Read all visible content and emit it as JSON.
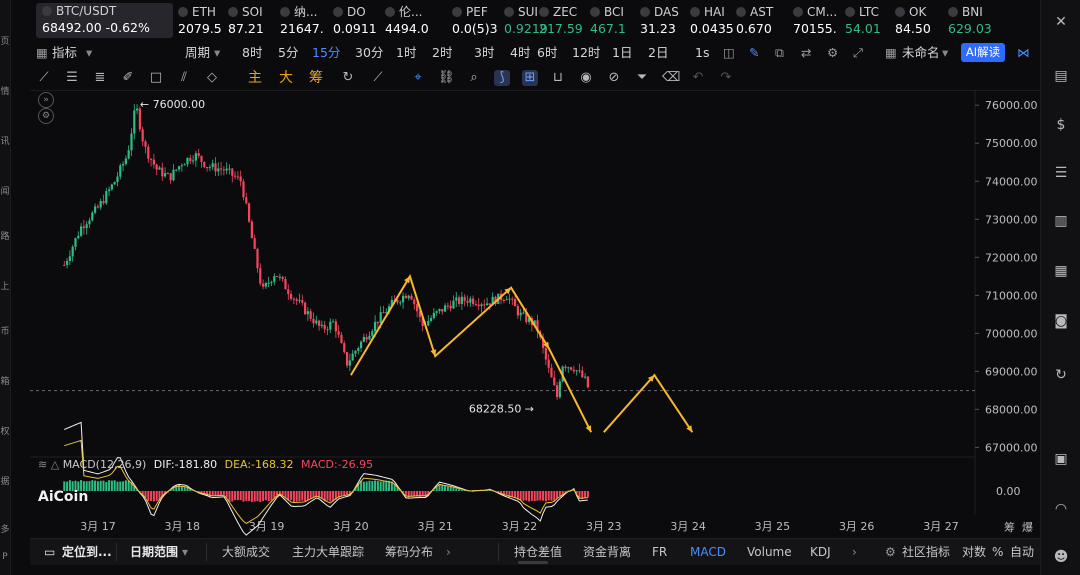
{
  "left_rail": [
    "页",
    "情",
    "讯",
    "闻",
    "路",
    "上",
    "币",
    "箱",
    "权",
    "据",
    "多",
    "P"
  ],
  "main_ticker": {
    "symbol": "BTC/USDT",
    "price": "68492.00",
    "change": "-0.62%"
  },
  "tickers": [
    {
      "sym": "ETH",
      "px": "2079.5",
      "color": "#ffffff"
    },
    {
      "sym": "SOI",
      "px": "87.21",
      "color": "#ffffff"
    },
    {
      "sym": "纳...",
      "px": "21647.",
      "color": "#ffffff"
    },
    {
      "sym": "DO",
      "px": "0.0911",
      "color": "#ffffff"
    },
    {
      "sym": "伦...",
      "px": "4494.0",
      "color": "#ffffff"
    },
    {
      "sym": "PEF",
      "px": "0.0(5)3",
      "color": "#ffffff"
    },
    {
      "sym": "SUI",
      "px": "0.9219",
      "color": "#2ebd85"
    },
    {
      "sym": "ZEC",
      "px": "217.59",
      "color": "#2ebd85"
    },
    {
      "sym": "BCI",
      "px": "467.1",
      "color": "#2ebd85"
    },
    {
      "sym": "DAS",
      "px": "31.23",
      "color": "#ffffff"
    },
    {
      "sym": "HAI",
      "px": "0.0435",
      "color": "#ffffff"
    },
    {
      "sym": "AST",
      "px": "0.670",
      "color": "#ffffff"
    },
    {
      "sym": "CM...",
      "px": "70155.",
      "color": "#ffffff"
    },
    {
      "sym": "LTC",
      "px": "54.01",
      "color": "#2ebd85"
    },
    {
      "sym": "OK",
      "px": "84.50",
      "color": "#ffffff"
    },
    {
      "sym": "BNI",
      "px": "629.03",
      "color": "#2ebd85"
    }
  ],
  "toolbar": {
    "indicator": "指标",
    "period": "周期",
    "timeframes": [
      "8时",
      "5分",
      "15分",
      "30分",
      "1时",
      "2时",
      "3时",
      "4时",
      "6时",
      "12时",
      "1日",
      "2日"
    ],
    "active_tf": "15分",
    "tick_1s": "1s",
    "unnamed": "未命名",
    "ai": "AI解读"
  },
  "draw_tools": {
    "zhu": "主",
    "da": "大",
    "chou": "筹"
  },
  "chart_data": {
    "type": "candlestick",
    "symbol": "BTC/USDT",
    "interval": "15分",
    "x_ticks": [
      "3月 17",
      "3月 18",
      "3月 19",
      "3月 20",
      "3月 21",
      "3月 22",
      "3月 23",
      "3月 24",
      "3月 25",
      "3月 26",
      "3月 27"
    ],
    "y_ticks": [
      "76000.00",
      "75000.00",
      "74000.00",
      "73000.00",
      "72000.00",
      "71000.00",
      "70000.00",
      "69000.00",
      "68000.00",
      "67000.00"
    ],
    "ylim": [
      66800,
      76400
    ],
    "high_label": "76000.00",
    "low_label": "68228.50",
    "last_price": 68492.0,
    "price_path": [
      {
        "d": "3月 16.6",
        "p": 71800
      },
      {
        "d": "3月 16.8",
        "p": 72800
      },
      {
        "d": "3月 17.0",
        "p": 73300
      },
      {
        "d": "3月 17.2",
        "p": 74000
      },
      {
        "d": "3月 17.35",
        "p": 74700
      },
      {
        "d": "3月 17.45",
        "p": 76000
      },
      {
        "d": "3月 17.55",
        "p": 74900
      },
      {
        "d": "3月 17.7",
        "p": 74300
      },
      {
        "d": "3月 17.85",
        "p": 74100
      },
      {
        "d": "3月 18.0",
        "p": 74500
      },
      {
        "d": "3月 18.15",
        "p": 74700
      },
      {
        "d": "3月 18.3",
        "p": 74400
      },
      {
        "d": "3月 18.5",
        "p": 74300
      },
      {
        "d": "3月 18.7",
        "p": 74000
      },
      {
        "d": "3月 18.85",
        "p": 72200
      },
      {
        "d": "3月 18.95",
        "p": 71100
      },
      {
        "d": "3月 19.1",
        "p": 71600
      },
      {
        "d": "3月 19.3",
        "p": 71000
      },
      {
        "d": "3月 19.5",
        "p": 70500
      },
      {
        "d": "3月 19.65",
        "p": 70100
      },
      {
        "d": "3月 19.8",
        "p": 70300
      },
      {
        "d": "3月 19.95",
        "p": 69200
      },
      {
        "d": "3月 20.1",
        "p": 69700
      },
      {
        "d": "3月 20.3",
        "p": 70300
      },
      {
        "d": "3月 20.5",
        "p": 70800
      },
      {
        "d": "3月 20.7",
        "p": 71100
      },
      {
        "d": "3月 20.85",
        "p": 70200
      },
      {
        "d": "3月 21.0",
        "p": 70500
      },
      {
        "d": "3月 21.2",
        "p": 70800
      },
      {
        "d": "3月 21.4",
        "p": 70900
      },
      {
        "d": "3月 21.6",
        "p": 70800
      },
      {
        "d": "3月 21.85",
        "p": 71000
      },
      {
        "d": "3月 22.0",
        "p": 70500
      },
      {
        "d": "3月 22.2",
        "p": 70200
      },
      {
        "d": "3月 22.35",
        "p": 69000
      },
      {
        "d": "3月 22.45",
        "p": 68300
      },
      {
        "d": "3月 22.5",
        "p": 69200
      },
      {
        "d": "3月 22.65",
        "p": 69100
      },
      {
        "d": "3月 22.8",
        "p": 68700
      },
      {
        "d": "3月 22.82",
        "p": 68492
      }
    ],
    "annotations": [
      {
        "type": "polyline",
        "color": "#f5b82e",
        "points": [
          {
            "d": "3月 20.0",
            "p": 68900
          },
          {
            "d": "3月 20.7",
            "p": 71500
          },
          {
            "d": "3月 21.0",
            "p": 69400
          },
          {
            "d": "3月 21.9",
            "p": 71200
          },
          {
            "d": "3月 22.35",
            "p": 69600
          },
          {
            "d": "3月 22.85",
            "p": 67400
          }
        ]
      },
      {
        "type": "polyline",
        "color": "#f5b82e",
        "points": [
          {
            "d": "3月 23.0",
            "p": 67400
          },
          {
            "d": "3月 23.6",
            "p": 68900
          },
          {
            "d": "3月 24.05",
            "p": 67400
          }
        ]
      }
    ],
    "macd": {
      "params": "MACD(12,26,9)",
      "dif_label": "DIF:-181.80",
      "dea_label": "DEA:-168.32",
      "macd_label": "MACD:-26.95",
      "y_tick": "0.00"
    }
  },
  "logo": "AiCoin",
  "corner_labels": {
    "a": "筹",
    "b": "爆"
  },
  "bottom": {
    "locate": "定位到...",
    "range": "日期范围",
    "big_trade": "大额成交",
    "main_order": "主力大单跟踪",
    "chip": "筹码分布",
    "position_diff": "持仓差值",
    "fund_diverge": "资金背离",
    "fr": "FR",
    "macd": "MACD",
    "volume": "Volume",
    "kdj": "KDJ",
    "community": "社区指标",
    "log": "对数",
    "pct": "%",
    "auto": "自动"
  },
  "colors": {
    "up": "#2ebd85",
    "down": "#f6465d",
    "accent": "#2f6bff",
    "annot": "#f5b82e",
    "dif": "#f0f0f0",
    "dea": "#e8c23a"
  }
}
